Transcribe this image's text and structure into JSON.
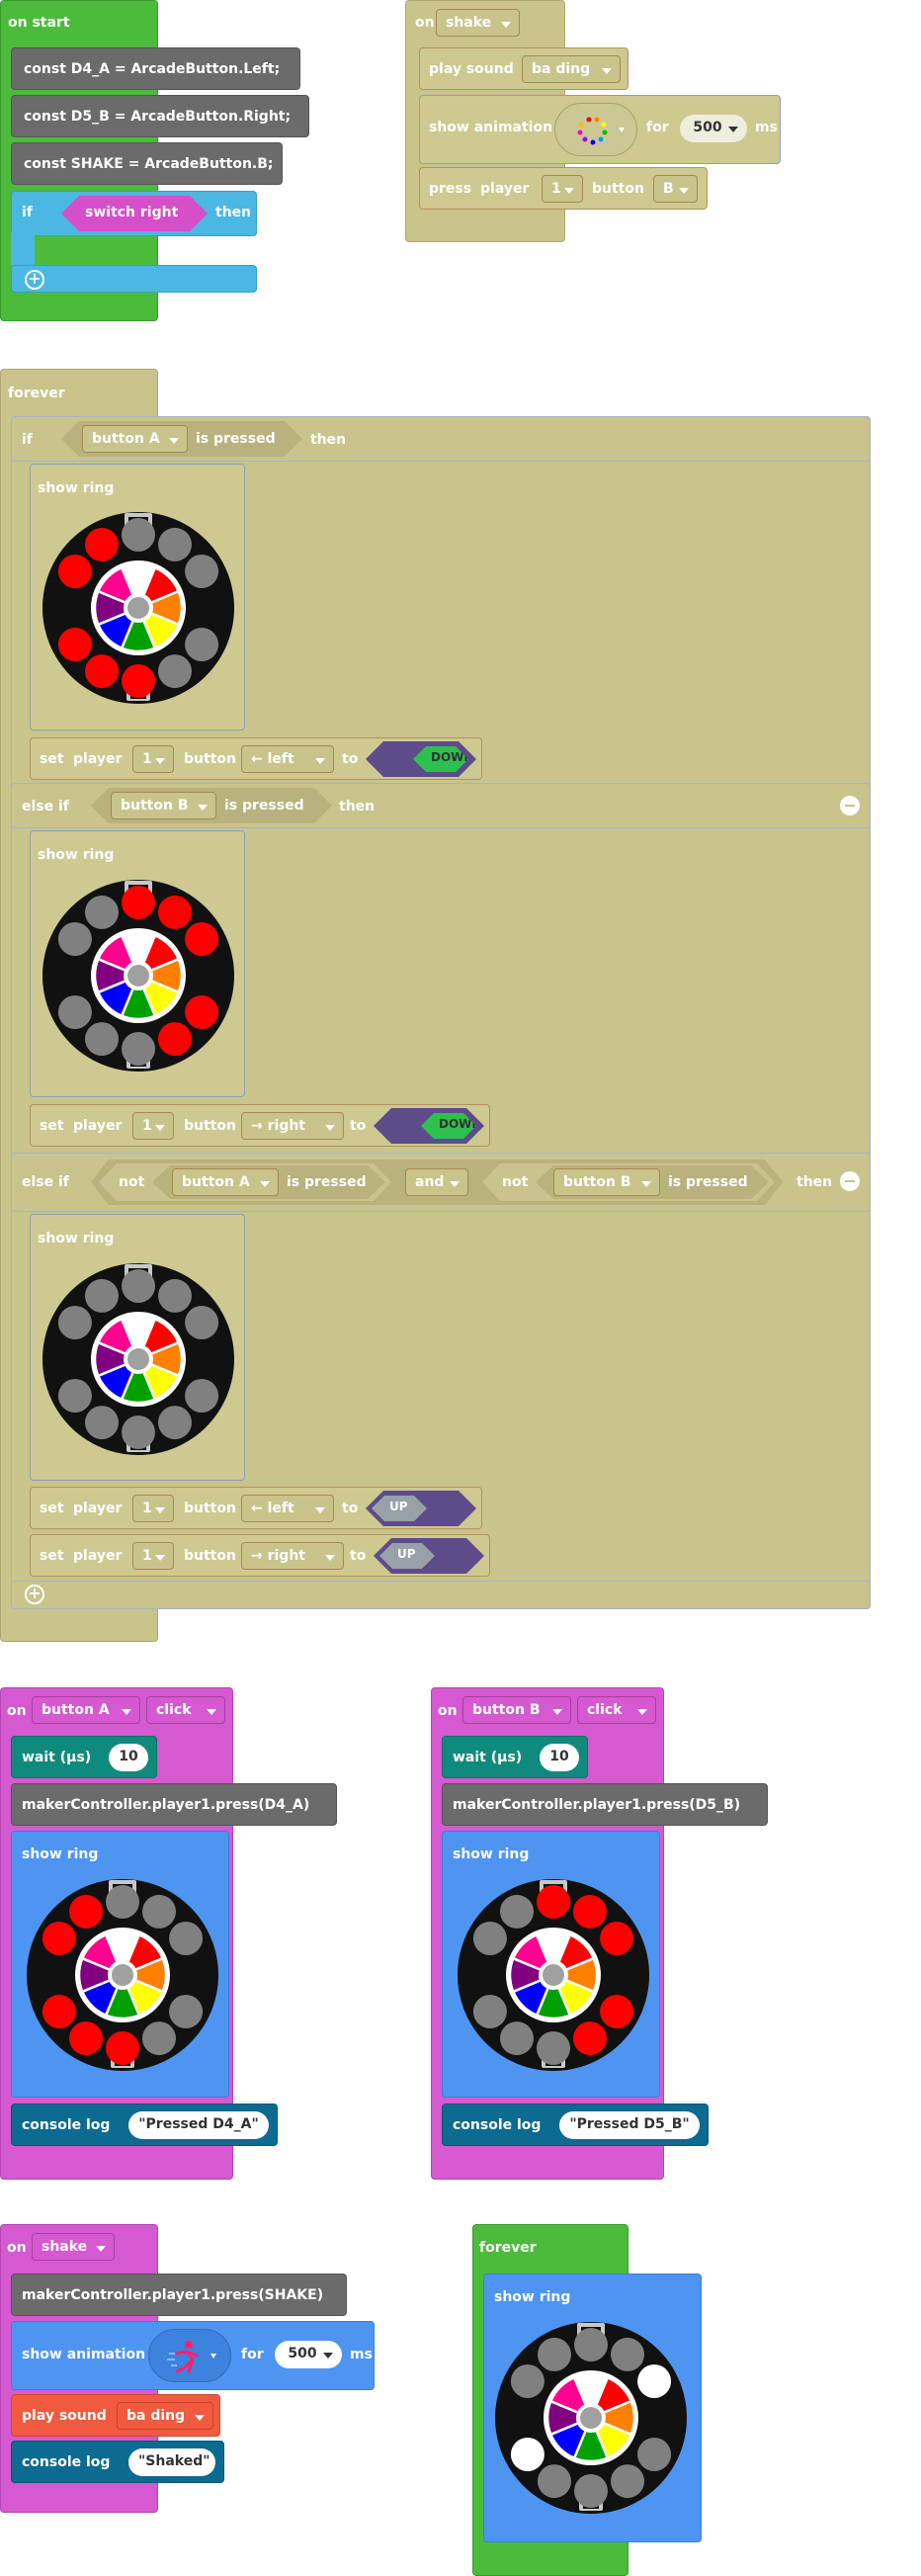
{
  "colors": {
    "loops_green": "#4cbb3c",
    "logic_teal": "#4bb7e3",
    "olive": "#c8c48c",
    "code_gray": "#6b6b6b",
    "events_magenta": "#d559d0",
    "ring_blue": "#4e95f2",
    "console_blue": "#0d6a90",
    "wait_teal": "#108a7c",
    "music_red": "#f15a3e",
    "down_hex_bg": "#5e4b8a",
    "down_green": "#2fbf4f",
    "up_gray": "#98a1a9"
  },
  "ring_colors": {
    "off": "#808080",
    "red": "#ff0000",
    "white": "#ffffff",
    "board": "#111111",
    "sectors": [
      "#ffffff",
      "#ff0000",
      "#ff8000",
      "#ffff00",
      "#00a000",
      "#0000ff",
      "#800080",
      "#ff0090"
    ]
  },
  "on_start": {
    "header": "on start",
    "const_a": "const D4_A = ArcadeButton.Left;",
    "const_b": "const D5_B = ArcadeButton.Right;",
    "const_shake": "const SHAKE = ArcadeButton.B;",
    "if_label": "if",
    "then_label": "then",
    "condition": "switch right"
  },
  "on_shake_top": {
    "on_label": "on",
    "event": "shake",
    "play_sound_label": "play sound",
    "sound": "ba ding",
    "show_animation_label": "show animation",
    "for_label": "for",
    "duration": "500",
    "ms_label": "ms",
    "press_label": "press",
    "player_label": "player",
    "player_value": "1",
    "button_label": "button",
    "button_value": "B"
  },
  "forever_main": {
    "header": "forever",
    "if_label": "if",
    "then_label": "then",
    "else_if_label": "else if",
    "is_pressed": "is pressed",
    "not_label": "not",
    "and_label": "and",
    "button_a": "button A",
    "button_b": "button B",
    "show_ring_label": "show ring",
    "set_label": "set",
    "player_label": "player",
    "player_value": "1",
    "button_label": "button",
    "to_label": "to",
    "left_value": "← left",
    "right_value": "→ right",
    "down_label": "DOWN",
    "up_label": "UP"
  },
  "on_button_a": {
    "on_label": "on",
    "button": "button A",
    "action": "click",
    "wait_label": "wait (µs)",
    "wait_value": "10",
    "press_code": "makerController.player1.press(D4_A)",
    "show_ring_label": "show ring",
    "console_label": "console log",
    "console_value": "\"Pressed D4_A\""
  },
  "on_button_b": {
    "on_label": "on",
    "button": "button B",
    "action": "click",
    "wait_label": "wait (µs)",
    "wait_value": "10",
    "press_code": "makerController.player1.press(D5_B)",
    "show_ring_label": "show ring",
    "console_label": "console log",
    "console_value": "\"Pressed D5_B\""
  },
  "on_shake_bottom": {
    "on_label": "on",
    "event": "shake",
    "press_code": "makerController.player1.press(SHAKE)",
    "show_animation_label": "show animation",
    "for_label": "for",
    "duration": "500",
    "ms_label": "ms",
    "play_sound_label": "play sound",
    "sound": "ba ding",
    "console_label": "console log",
    "console_value": "\"Shaked\""
  },
  "forever_small": {
    "header": "forever",
    "show_ring_label": "show ring"
  },
  "rings": {
    "ring_a": [
      "red",
      "red",
      "off",
      "off",
      "off",
      "off",
      "off",
      "red",
      "red",
      "red"
    ],
    "ring_b": [
      "off",
      "off",
      "red",
      "red",
      "red",
      "red",
      "red",
      "off",
      "off",
      "off"
    ],
    "ring_none": [
      "off",
      "off",
      "off",
      "off",
      "off",
      "off",
      "off",
      "off",
      "off",
      "off"
    ],
    "ring_btn_a": [
      "red",
      "red",
      "off",
      "off",
      "off",
      "off",
      "off",
      "red",
      "red",
      "red"
    ],
    "ring_btn_b": [
      "off",
      "off",
      "red",
      "red",
      "red",
      "red",
      "red",
      "off",
      "off",
      "off"
    ],
    "ring_small": [
      "off",
      "off",
      "off",
      "off",
      "white",
      "off",
      "off",
      "off",
      "off",
      "white"
    ]
  }
}
